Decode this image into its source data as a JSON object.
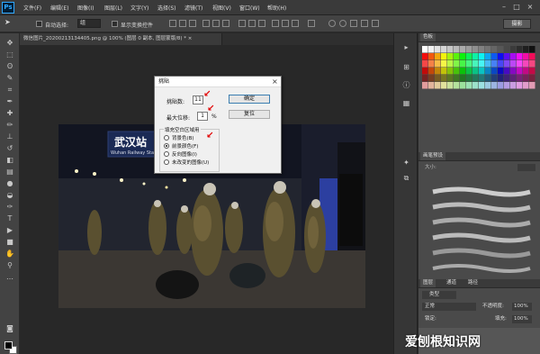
{
  "app": {
    "logo": "Ps"
  },
  "menus": [
    "文件(F)",
    "编辑(E)",
    "图像(I)",
    "图层(L)",
    "文字(Y)",
    "选择(S)",
    "滤镜(T)",
    "视图(V)",
    "窗口(W)",
    "帮助(H)"
  ],
  "window_controls": [
    "–",
    "□",
    "×"
  ],
  "options_bar": {
    "auto_select_label": "自动选择:",
    "auto_select_value": "组",
    "show_transform_label": "显示变换控件",
    "workspace_label": "摄影"
  },
  "document": {
    "tab_title": "微信图片_20200213134405.png @ 100% (图层 0 副本, 图层蒙版/8) * ×"
  },
  "photo": {
    "sign_text": "武汉站",
    "sign_sub": "Wuhan Railway Sta"
  },
  "dialog": {
    "title": "挑貼",
    "close": "×",
    "radius_label": "挑貼数:",
    "radius_value": "11",
    "max_offset_label": "最大位移:",
    "max_offset_value": "1",
    "percent": "%",
    "ok_label": "确定",
    "reset_label": "复位",
    "group_label": "填充空白区域用",
    "options": [
      {
        "label": "背景色(B)",
        "checked": false
      },
      {
        "label": "前景颜色(F)",
        "checked": true
      },
      {
        "label": "反向图像(I)",
        "checked": false
      },
      {
        "label": "未改变的图像(U)",
        "checked": false
      }
    ]
  },
  "panels": {
    "swatches_tab": "色板",
    "brush_preset_tab": "画笔预设",
    "size_label": "大小:",
    "layers_tab": "图层",
    "channels_tab": "通道",
    "paths_tab": "路径",
    "kind_label": "类型",
    "blend_mode": "正常",
    "opacity_label": "不透明度:",
    "opacity_value": "100%",
    "lock_label": "锁定:",
    "fill_label": "填充:",
    "fill_value": "100%"
  },
  "watermark": "爱刨根知识网"
}
